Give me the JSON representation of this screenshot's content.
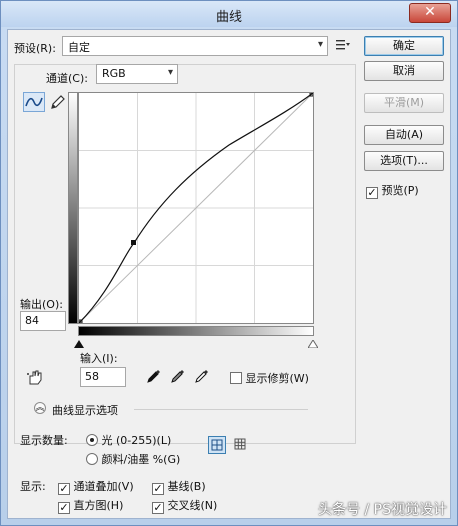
{
  "window": {
    "title": "曲线",
    "close_glyph": "✕"
  },
  "preset": {
    "label": "预设(R):",
    "value": "自定"
  },
  "channel": {
    "label": "通道(C):",
    "value": "RGB"
  },
  "buttons": {
    "ok": "确定",
    "cancel": "取消",
    "smooth": "平滑(M)",
    "auto": "自动(A)",
    "options": "选项(T)..."
  },
  "preview": {
    "label": "预览(P)",
    "checked": true
  },
  "output": {
    "label": "输出(O):",
    "value": "84"
  },
  "input": {
    "label": "输入(I):",
    "value": "58"
  },
  "show_clipping": {
    "label": "显示修剪(W)",
    "checked": false
  },
  "curve_display": {
    "section_title": "曲线显示选项"
  },
  "show_amount": {
    "label": "显示数量:",
    "option_light": "光 (0-255)(L)",
    "option_pigment": "颜料/油墨 %(G)",
    "selected": "light"
  },
  "show": {
    "label": "显示:",
    "channel_overlays": "通道叠加(V)",
    "baseline": "基线(B)",
    "histogram": "直方图(H)",
    "intersection_line": "交叉线(N)"
  },
  "watermark": "头条号 / PS视觉设计"
}
